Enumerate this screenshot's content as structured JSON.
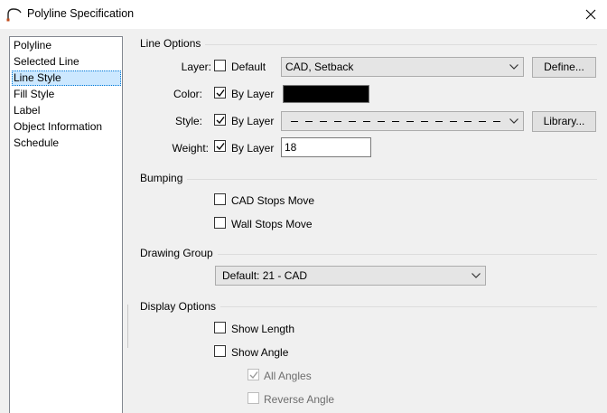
{
  "window": {
    "title": "Polyline Specification",
    "icon": "arc-icon",
    "close_icon": "close-icon"
  },
  "nav": {
    "items": [
      {
        "label": "Polyline",
        "selected": false
      },
      {
        "label": "Selected Line",
        "selected": false
      },
      {
        "label": "Line Style",
        "selected": true
      },
      {
        "label": "Fill Style",
        "selected": false
      },
      {
        "label": "Label",
        "selected": false
      },
      {
        "label": "Object Information",
        "selected": false
      },
      {
        "label": "Schedule",
        "selected": false
      }
    ]
  },
  "line_options": {
    "header": "Line Options",
    "layer": {
      "label": "Layer:",
      "default_label": "Default",
      "default_checked": false,
      "value": "CAD, Setback",
      "button": "Define..."
    },
    "color": {
      "label": "Color:",
      "by_layer_label": "By Layer",
      "by_layer_checked": true,
      "swatch": "#000000"
    },
    "style": {
      "label": "Style:",
      "by_layer_label": "By Layer",
      "by_layer_checked": true,
      "value": "dashed",
      "button": "Library..."
    },
    "weight": {
      "label": "Weight:",
      "by_layer_label": "By Layer",
      "by_layer_checked": true,
      "value": "18"
    }
  },
  "bumping": {
    "header": "Bumping",
    "cad_stops_move": {
      "label": "CAD Stops Move",
      "checked": false
    },
    "wall_stops_move": {
      "label": "Wall Stops Move",
      "checked": false
    }
  },
  "drawing_group": {
    "header": "Drawing Group",
    "value": "Default: 21 - CAD"
  },
  "display_options": {
    "header": "Display Options",
    "show_length": {
      "label": "Show Length",
      "checked": false
    },
    "show_angle": {
      "label": "Show Angle",
      "checked": false
    },
    "all_angles": {
      "label": "All Angles",
      "checked": true,
      "disabled": true
    },
    "reverse_angle": {
      "label": "Reverse Angle",
      "checked": false,
      "disabled": true
    }
  },
  "colors": {
    "selection_bg": "#cce8ff",
    "selection_border": "#0078d7",
    "dialog_bg": "#f0f0f0"
  }
}
